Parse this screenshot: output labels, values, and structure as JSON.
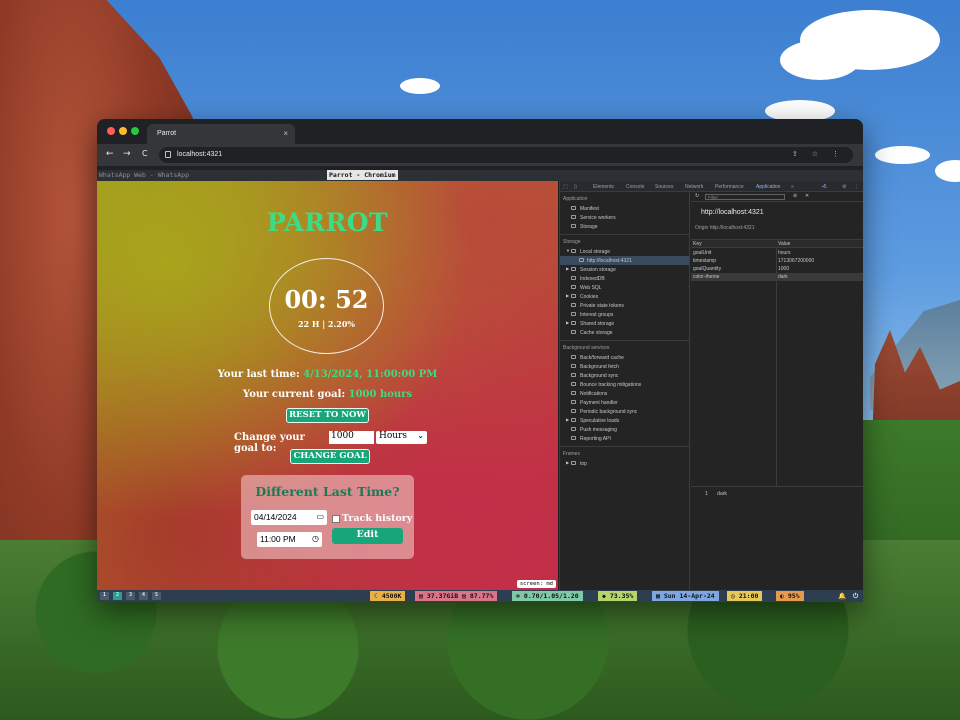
{
  "browser": {
    "tab_title": "Parrot",
    "tab_close": "×",
    "url": "localhost:4321",
    "nav_back": "←",
    "nav_forward": "→",
    "nav_reload": "C",
    "omni_actions": "⇪ ☆ ⋮"
  },
  "wm": {
    "left_title": "WhatsApp Web - WhatsApp",
    "focused_title": "Parrot - Chromium"
  },
  "app": {
    "title": "PARROT",
    "timer_value": "00: 52",
    "timer_sub": "22 H | 2.20%",
    "last_time_label": "Your last time:",
    "last_time_value": "4/13/2024, 11:00:00 PM",
    "goal_label": "Your current goal:",
    "goal_value": "1000 hours",
    "reset_button": "RESET TO NOW",
    "change_goal_label": "Change your goal to:",
    "goal_input_value": "1000",
    "goal_unit_selected": "Hours",
    "change_goal_button": "CHANGE GOAL",
    "card_title": "Different Last Time?",
    "date_value": "04/14/2024",
    "time_value": "11:00 PM",
    "track_history_label": "Track history",
    "edit_button": "Edit",
    "screen_badge": "screen: md"
  },
  "devtools": {
    "tabs": [
      "Elements",
      "Console",
      "Sources",
      "Network",
      "Performance",
      "Application",
      "»"
    ],
    "section_application": "Application",
    "app_items": [
      "Manifest",
      "Service workers",
      "Storage"
    ],
    "section_storage": "Storage",
    "storage_items": [
      "Local storage",
      "http://localhost:4321",
      "Session storage",
      "IndexedDB",
      "Web SQL",
      "Cookies",
      "Private state tokens",
      "Interest groups",
      "Shared storage",
      "Cache storage"
    ],
    "section_background": "Background services",
    "background_items": [
      "Back/forward cache",
      "Background fetch",
      "Background sync",
      "Bounce tracking mitigations",
      "Notifications",
      "Payment handler",
      "Periodic background sync",
      "Speculative loads",
      "Push messaging",
      "Reporting API"
    ],
    "section_frames": "Frames",
    "frames_items": [
      "top"
    ],
    "filter_placeholder": "Filter",
    "origin_big": "http://localhost:4321",
    "origin_label": "Origin",
    "origin_value": "http://localhost:4321",
    "col_key": "Key",
    "col_value": "Value",
    "rows": [
      {
        "key": "goalUnit",
        "value": "hours"
      },
      {
        "key": "timestamp",
        "value": "1713067200000"
      },
      {
        "key": "goalQuantity",
        "value": "1000"
      },
      {
        "key": "color-theme",
        "value": "dark"
      }
    ],
    "preview_index": "1",
    "preview_value": "dark"
  },
  "statusbar": {
    "workspaces": [
      "1",
      "2",
      "3",
      "4",
      "5"
    ],
    "segments": [
      {
        "text": "☾ 4500K",
        "color": "#e8b04a"
      },
      {
        "text": "▤ 37.37GiB ▤ 87.77%",
        "color": "#d9748a"
      },
      {
        "text": "✻ 0.70/1.05/1.20",
        "color": "#7fc8a9"
      },
      {
        "text": "◆ 73.35%",
        "color": "#b4d46c"
      },
      {
        "text": "▦ Sun 14-Apr-24",
        "color": "#7ea6e0"
      },
      {
        "text": "◷ 21:00",
        "color": "#e7c65a"
      },
      {
        "text": "◐ 95%",
        "color": "#e59a4e"
      }
    ]
  }
}
